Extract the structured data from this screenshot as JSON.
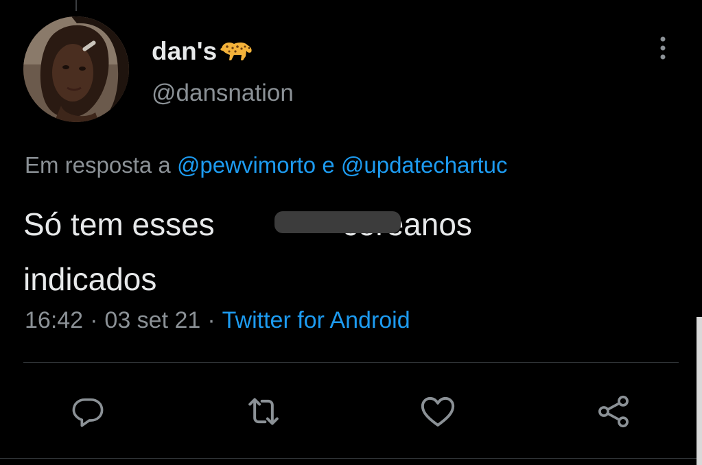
{
  "tweet": {
    "author": {
      "display_name": "dan's",
      "name_emoji": "leopard-emoji",
      "handle": "@dansnation"
    },
    "reply_context": {
      "prefix": "Em resposta a",
      "mention_1": "@pewvimorto",
      "conjunction": "e",
      "mention_2": "@updatechartuc"
    },
    "text": {
      "before_redaction": "Só tem esses",
      "after_redaction": "coreanos",
      "line_2": "indicados"
    },
    "meta": {
      "time": "16:42",
      "separator": "·",
      "date": "03 set 21",
      "source": "Twitter for Android"
    },
    "actions": [
      "reply-icon",
      "retweet-icon",
      "like-icon",
      "share-icon"
    ]
  },
  "colors": {
    "background": "#000000",
    "text": "#e7e9ea",
    "secondary": "#8b9196",
    "link": "#1d9bf0"
  }
}
